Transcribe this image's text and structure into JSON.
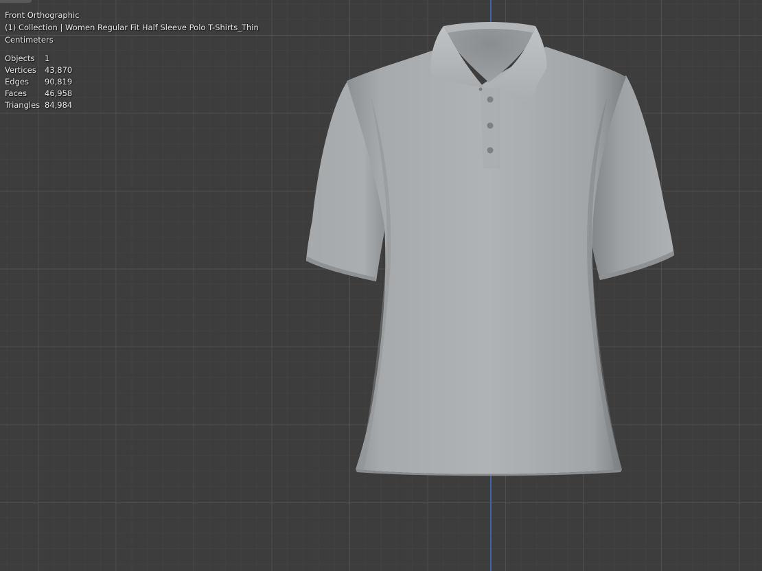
{
  "viewport": {
    "view_name": "Front Orthographic",
    "collection_name": "(1) Collection | Women Regular Fit Half Sleeve Polo T-Shirts_Thin",
    "units": "Centimeters",
    "background_color": "#3d3d3d",
    "axis_color": "#3f63a8"
  },
  "stats": [
    {
      "label": "Objects",
      "value": "1"
    },
    {
      "label": "Vertices",
      "value": "43,870"
    },
    {
      "label": "Edges",
      "value": "90,819"
    },
    {
      "label": "Faces",
      "value": "46,958"
    },
    {
      "label": "Triangles",
      "value": "84,984"
    }
  ],
  "model": {
    "icon": "polo-shirt-mesh",
    "color": "#a9acae"
  }
}
